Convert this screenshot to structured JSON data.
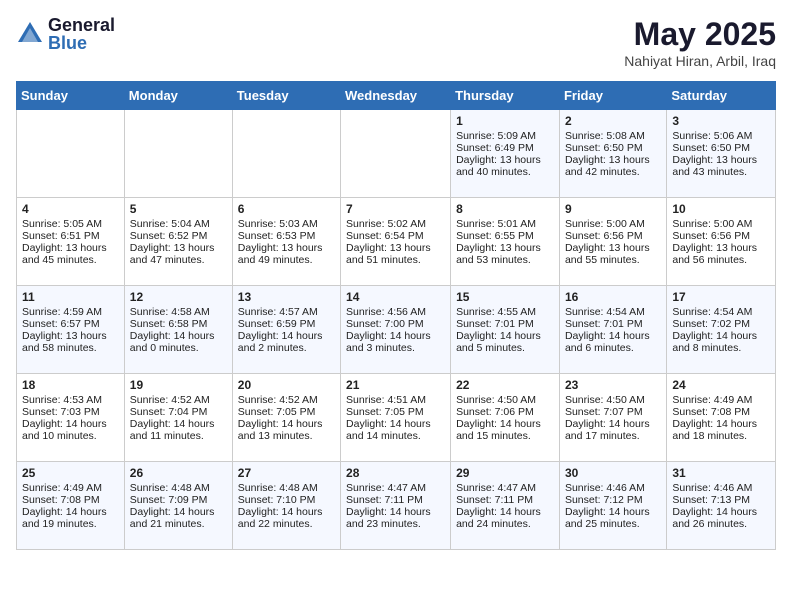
{
  "logo": {
    "general": "General",
    "blue": "Blue"
  },
  "header": {
    "month": "May 2025",
    "location": "Nahiyat Hiran, Arbil, Iraq"
  },
  "days_of_week": [
    "Sunday",
    "Monday",
    "Tuesday",
    "Wednesday",
    "Thursday",
    "Friday",
    "Saturday"
  ],
  "weeks": [
    [
      {
        "day": "",
        "sunrise": "",
        "sunset": "",
        "daylight": ""
      },
      {
        "day": "",
        "sunrise": "",
        "sunset": "",
        "daylight": ""
      },
      {
        "day": "",
        "sunrise": "",
        "sunset": "",
        "daylight": ""
      },
      {
        "day": "",
        "sunrise": "",
        "sunset": "",
        "daylight": ""
      },
      {
        "day": "1",
        "sunrise": "Sunrise: 5:09 AM",
        "sunset": "Sunset: 6:49 PM",
        "daylight": "Daylight: 13 hours and 40 minutes."
      },
      {
        "day": "2",
        "sunrise": "Sunrise: 5:08 AM",
        "sunset": "Sunset: 6:50 PM",
        "daylight": "Daylight: 13 hours and 42 minutes."
      },
      {
        "day": "3",
        "sunrise": "Sunrise: 5:06 AM",
        "sunset": "Sunset: 6:50 PM",
        "daylight": "Daylight: 13 hours and 43 minutes."
      }
    ],
    [
      {
        "day": "4",
        "sunrise": "Sunrise: 5:05 AM",
        "sunset": "Sunset: 6:51 PM",
        "daylight": "Daylight: 13 hours and 45 minutes."
      },
      {
        "day": "5",
        "sunrise": "Sunrise: 5:04 AM",
        "sunset": "Sunset: 6:52 PM",
        "daylight": "Daylight: 13 hours and 47 minutes."
      },
      {
        "day": "6",
        "sunrise": "Sunrise: 5:03 AM",
        "sunset": "Sunset: 6:53 PM",
        "daylight": "Daylight: 13 hours and 49 minutes."
      },
      {
        "day": "7",
        "sunrise": "Sunrise: 5:02 AM",
        "sunset": "Sunset: 6:54 PM",
        "daylight": "Daylight: 13 hours and 51 minutes."
      },
      {
        "day": "8",
        "sunrise": "Sunrise: 5:01 AM",
        "sunset": "Sunset: 6:55 PM",
        "daylight": "Daylight: 13 hours and 53 minutes."
      },
      {
        "day": "9",
        "sunrise": "Sunrise: 5:00 AM",
        "sunset": "Sunset: 6:56 PM",
        "daylight": "Daylight: 13 hours and 55 minutes."
      },
      {
        "day": "10",
        "sunrise": "Sunrise: 5:00 AM",
        "sunset": "Sunset: 6:56 PM",
        "daylight": "Daylight: 13 hours and 56 minutes."
      }
    ],
    [
      {
        "day": "11",
        "sunrise": "Sunrise: 4:59 AM",
        "sunset": "Sunset: 6:57 PM",
        "daylight": "Daylight: 13 hours and 58 minutes."
      },
      {
        "day": "12",
        "sunrise": "Sunrise: 4:58 AM",
        "sunset": "Sunset: 6:58 PM",
        "daylight": "Daylight: 14 hours and 0 minutes."
      },
      {
        "day": "13",
        "sunrise": "Sunrise: 4:57 AM",
        "sunset": "Sunset: 6:59 PM",
        "daylight": "Daylight: 14 hours and 2 minutes."
      },
      {
        "day": "14",
        "sunrise": "Sunrise: 4:56 AM",
        "sunset": "Sunset: 7:00 PM",
        "daylight": "Daylight: 14 hours and 3 minutes."
      },
      {
        "day": "15",
        "sunrise": "Sunrise: 4:55 AM",
        "sunset": "Sunset: 7:01 PM",
        "daylight": "Daylight: 14 hours and 5 minutes."
      },
      {
        "day": "16",
        "sunrise": "Sunrise: 4:54 AM",
        "sunset": "Sunset: 7:01 PM",
        "daylight": "Daylight: 14 hours and 6 minutes."
      },
      {
        "day": "17",
        "sunrise": "Sunrise: 4:54 AM",
        "sunset": "Sunset: 7:02 PM",
        "daylight": "Daylight: 14 hours and 8 minutes."
      }
    ],
    [
      {
        "day": "18",
        "sunrise": "Sunrise: 4:53 AM",
        "sunset": "Sunset: 7:03 PM",
        "daylight": "Daylight: 14 hours and 10 minutes."
      },
      {
        "day": "19",
        "sunrise": "Sunrise: 4:52 AM",
        "sunset": "Sunset: 7:04 PM",
        "daylight": "Daylight: 14 hours and 11 minutes."
      },
      {
        "day": "20",
        "sunrise": "Sunrise: 4:52 AM",
        "sunset": "Sunset: 7:05 PM",
        "daylight": "Daylight: 14 hours and 13 minutes."
      },
      {
        "day": "21",
        "sunrise": "Sunrise: 4:51 AM",
        "sunset": "Sunset: 7:05 PM",
        "daylight": "Daylight: 14 hours and 14 minutes."
      },
      {
        "day": "22",
        "sunrise": "Sunrise: 4:50 AM",
        "sunset": "Sunset: 7:06 PM",
        "daylight": "Daylight: 14 hours and 15 minutes."
      },
      {
        "day": "23",
        "sunrise": "Sunrise: 4:50 AM",
        "sunset": "Sunset: 7:07 PM",
        "daylight": "Daylight: 14 hours and 17 minutes."
      },
      {
        "day": "24",
        "sunrise": "Sunrise: 4:49 AM",
        "sunset": "Sunset: 7:08 PM",
        "daylight": "Daylight: 14 hours and 18 minutes."
      }
    ],
    [
      {
        "day": "25",
        "sunrise": "Sunrise: 4:49 AM",
        "sunset": "Sunset: 7:08 PM",
        "daylight": "Daylight: 14 hours and 19 minutes."
      },
      {
        "day": "26",
        "sunrise": "Sunrise: 4:48 AM",
        "sunset": "Sunset: 7:09 PM",
        "daylight": "Daylight: 14 hours and 21 minutes."
      },
      {
        "day": "27",
        "sunrise": "Sunrise: 4:48 AM",
        "sunset": "Sunset: 7:10 PM",
        "daylight": "Daylight: 14 hours and 22 minutes."
      },
      {
        "day": "28",
        "sunrise": "Sunrise: 4:47 AM",
        "sunset": "Sunset: 7:11 PM",
        "daylight": "Daylight: 14 hours and 23 minutes."
      },
      {
        "day": "29",
        "sunrise": "Sunrise: 4:47 AM",
        "sunset": "Sunset: 7:11 PM",
        "daylight": "Daylight: 14 hours and 24 minutes."
      },
      {
        "day": "30",
        "sunrise": "Sunrise: 4:46 AM",
        "sunset": "Sunset: 7:12 PM",
        "daylight": "Daylight: 14 hours and 25 minutes."
      },
      {
        "day": "31",
        "sunrise": "Sunrise: 4:46 AM",
        "sunset": "Sunset: 7:13 PM",
        "daylight": "Daylight: 14 hours and 26 minutes."
      }
    ]
  ]
}
